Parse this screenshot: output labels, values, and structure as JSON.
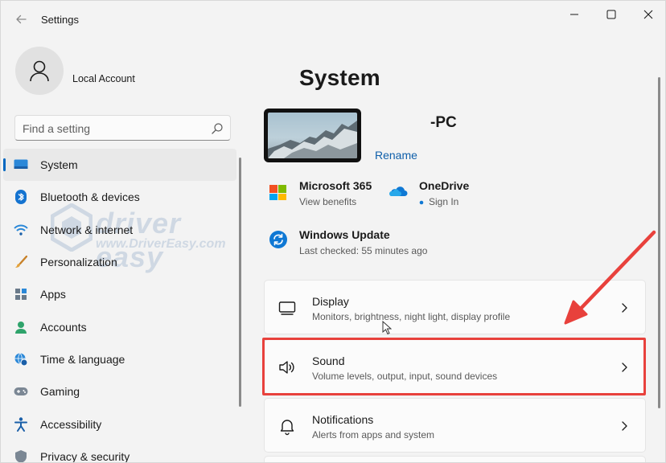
{
  "window": {
    "title": "Settings"
  },
  "account": {
    "name": "Local Account"
  },
  "search": {
    "placeholder": "Find a setting"
  },
  "nav": [
    {
      "label": "System",
      "icon": "monitor-icon",
      "active": true
    },
    {
      "label": "Bluetooth & devices",
      "icon": "bluetooth-icon"
    },
    {
      "label": "Network & internet",
      "icon": "wifi-icon"
    },
    {
      "label": "Personalization",
      "icon": "brush-icon"
    },
    {
      "label": "Apps",
      "icon": "apps-icon"
    },
    {
      "label": "Accounts",
      "icon": "person-icon"
    },
    {
      "label": "Time & language",
      "icon": "globe-clock-icon"
    },
    {
      "label": "Gaming",
      "icon": "gamepad-icon"
    },
    {
      "label": "Accessibility",
      "icon": "accessibility-icon"
    },
    {
      "label": "Privacy & security",
      "icon": "shield-icon"
    }
  ],
  "main": {
    "title": "System",
    "pc_name": "-PC",
    "rename_label": "Rename",
    "tiles": {
      "m365": {
        "title": "Microsoft 365",
        "sub": "View benefits"
      },
      "onedrive": {
        "title": "OneDrive",
        "sub": "Sign In"
      },
      "update": {
        "title": "Windows Update",
        "sub": "Last checked: 55 minutes ago"
      }
    },
    "cards": [
      {
        "title": "Display",
        "sub": "Monitors, brightness, night light, display profile",
        "icon": "display-icon"
      },
      {
        "title": "Sound",
        "sub": "Volume levels, output, input, sound devices",
        "icon": "speaker-icon"
      },
      {
        "title": "Notifications",
        "sub": "Alerts from apps and system",
        "icon": "bell-icon"
      }
    ]
  },
  "watermark": {
    "brand": "driver easy",
    "url": "www.DriverEasy.com"
  },
  "colors": {
    "accent": "#0067c0",
    "highlight": "#e8413c",
    "link": "#0f5faa"
  }
}
